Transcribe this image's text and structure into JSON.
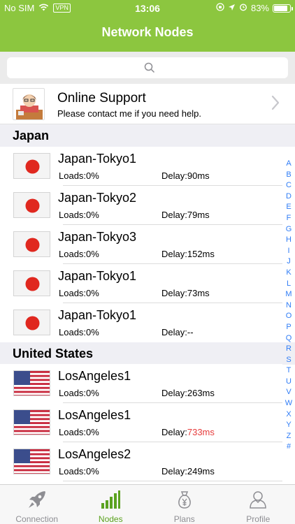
{
  "status_bar": {
    "carrier": "No SIM",
    "vpn": "VPN",
    "time": "13:06",
    "battery": "83%",
    "battery_level": 0.83
  },
  "nav": {
    "title": "Network Nodes"
  },
  "colors": {
    "accent": "#8cc63f",
    "active_tab": "#5ba21f",
    "link_blue": "#2f7cf6",
    "high_delay": "#e63b3b"
  },
  "support": {
    "title": "Online Support",
    "subtitle": "Please contact me if you need help."
  },
  "sections": [
    {
      "title": "Japan",
      "flag": "japan-flag",
      "nodes": [
        {
          "name": "Japan-Tokyo1",
          "loads": "Loads:0%",
          "delay_label": "Delay:",
          "delay_value": "90ms",
          "high": false
        },
        {
          "name": "Japan-Tokyo2",
          "loads": "Loads:0%",
          "delay_label": "Delay:",
          "delay_value": "79ms",
          "high": false
        },
        {
          "name": "Japan-Tokyo3",
          "loads": "Loads:0%",
          "delay_label": "Delay:",
          "delay_value": "152ms",
          "high": false
        },
        {
          "name": "Japan-Tokyo1",
          "loads": "Loads:0%",
          "delay_label": "Delay:",
          "delay_value": "73ms",
          "high": false
        },
        {
          "name": "Japan-Tokyo1",
          "loads": "Loads:0%",
          "delay_label": "Delay:",
          "delay_value": "--",
          "high": false
        }
      ]
    },
    {
      "title": "United States",
      "flag": "us-flag",
      "nodes": [
        {
          "name": "LosAngeles1",
          "loads": "Loads:0%",
          "delay_label": "Delay:",
          "delay_value": "263ms",
          "high": false
        },
        {
          "name": "LosAngeles1",
          "loads": "Loads:0%",
          "delay_label": "Delay:",
          "delay_value": "733ms",
          "high": true
        },
        {
          "name": "LosAngeles2",
          "loads": "Loads:0%",
          "delay_label": "Delay:",
          "delay_value": "249ms",
          "high": false
        }
      ]
    }
  ],
  "index_letters": [
    "A",
    "B",
    "C",
    "D",
    "E",
    "F",
    "G",
    "H",
    "I",
    "J",
    "K",
    "L",
    "M",
    "N",
    "O",
    "P",
    "Q",
    "R",
    "S",
    "T",
    "U",
    "V",
    "W",
    "X",
    "Y",
    "Z",
    "#"
  ],
  "tabs": [
    {
      "label": "Connection",
      "icon": "rocket-icon",
      "active": false
    },
    {
      "label": "Nodes",
      "icon": "signal-bars-icon",
      "active": true
    },
    {
      "label": "Plans",
      "icon": "money-bag-icon",
      "active": false
    },
    {
      "label": "Profile",
      "icon": "person-icon",
      "active": false
    }
  ]
}
